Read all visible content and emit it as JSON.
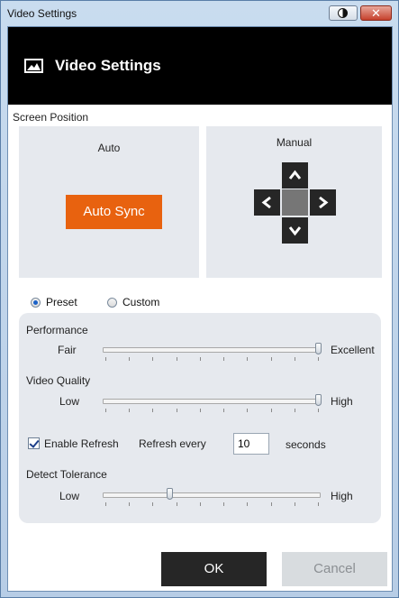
{
  "window": {
    "title": "Video Settings"
  },
  "header": {
    "title": "Video Settings",
    "icon": "image-icon"
  },
  "screen_position": {
    "label": "Screen Position",
    "auto": {
      "title": "Auto",
      "button_label": "Auto Sync",
      "button_color": "#e8620f"
    },
    "manual": {
      "title": "Manual"
    }
  },
  "mode": {
    "options": [
      "Preset",
      "Custom"
    ],
    "selected": "Preset"
  },
  "performance": {
    "label": "Performance",
    "min_label": "Fair",
    "max_label": "Excellent",
    "value": 1.0
  },
  "video_quality": {
    "label": "Video Quality",
    "min_label": "Low",
    "max_label": "High",
    "value": 1.0
  },
  "refresh": {
    "enable_label": "Enable Refresh",
    "enabled": true,
    "every_label": "Refresh every",
    "value": "10",
    "unit": "seconds"
  },
  "detect_tolerance": {
    "label": "Detect Tolerance",
    "min_label": "Low",
    "max_label": "High",
    "value": 0.3
  },
  "buttons": {
    "ok": "OK",
    "cancel": "Cancel"
  },
  "colors": {
    "accent": "#e8620f",
    "header_bg": "#000000",
    "panel_bg": "#e6e9ee"
  }
}
